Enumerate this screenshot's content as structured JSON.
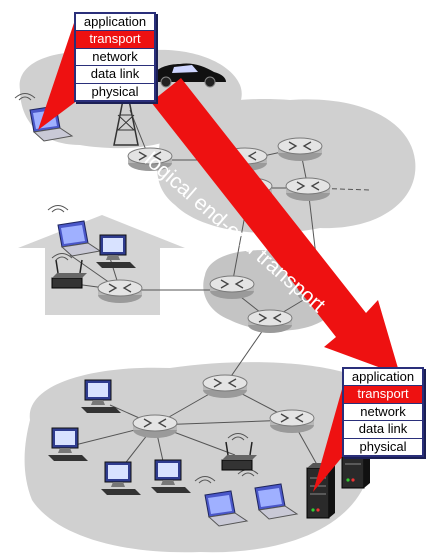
{
  "colors": {
    "accent": "#ee1111",
    "layer_border": "#2a2f7a",
    "network_blob": "#cfcfcf",
    "router": "#dcdcdc"
  },
  "stacks": {
    "source": {
      "layers": [
        {
          "label": "application",
          "active": false
        },
        {
          "label": "transport",
          "active": true
        },
        {
          "label": "network",
          "active": false
        },
        {
          "label": "data link",
          "active": false
        },
        {
          "label": "physical",
          "active": false
        }
      ]
    },
    "destination": {
      "layers": [
        {
          "label": "application",
          "active": false
        },
        {
          "label": "transport",
          "active": true
        },
        {
          "label": "network",
          "active": false
        },
        {
          "label": "data link",
          "active": false
        },
        {
          "label": "physical",
          "active": false
        }
      ]
    }
  },
  "arrow": {
    "label": "logical end-end transport"
  },
  "icons": [
    "router-icon",
    "laptop-icon",
    "desktop-icon",
    "server-icon",
    "wireless-ap-icon",
    "cell-tower-icon",
    "car-icon",
    "house-icon"
  ]
}
